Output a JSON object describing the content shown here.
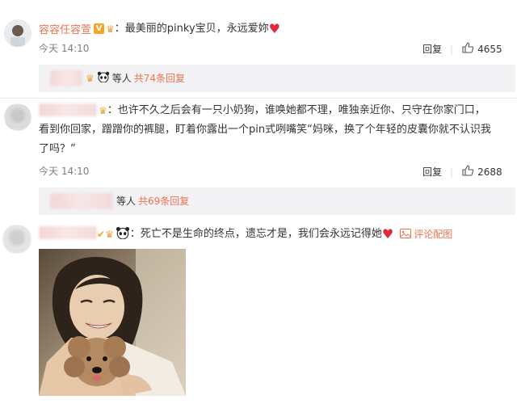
{
  "comments": [
    {
      "username": "容容任容萱",
      "text_prefix": "：最美丽的pinky宝贝，永远爱妳",
      "time": "今天 14:10",
      "reply_label": "回复",
      "like_count": "4655",
      "replies": {
        "text": "等人",
        "count": "共74条回复"
      }
    },
    {
      "text_lines": [
        "：也许不久之后会有一只小奶狗，谁唤她都不理，唯独亲近你、只守在你家门口，",
        "看到你回家，蹭蹭你的裤腿，盯着你露出一个pin式咧嘴笑“妈咪，换了个年轻的皮囊你就不认识我",
        "了吗？”"
      ],
      "time": "今天 14:10",
      "reply_label": "回复",
      "like_count": "2688",
      "replies": {
        "text": "等人",
        "count": "共69条回复"
      }
    },
    {
      "text": "：死亡不是生命的终点，遗忘才是，我们会永远记得她",
      "comment_with_image": "评论配图"
    }
  ],
  "icons": {
    "vip_badge": "V",
    "crown": "crown-icon",
    "panda": "panda-icon",
    "heart": "heart-icon",
    "like": "thumbs-up-icon",
    "image": "image-icon"
  },
  "colors": {
    "username": "#eb7350",
    "heart": "#e0293a",
    "reply_bg": "#f2f2f5"
  }
}
